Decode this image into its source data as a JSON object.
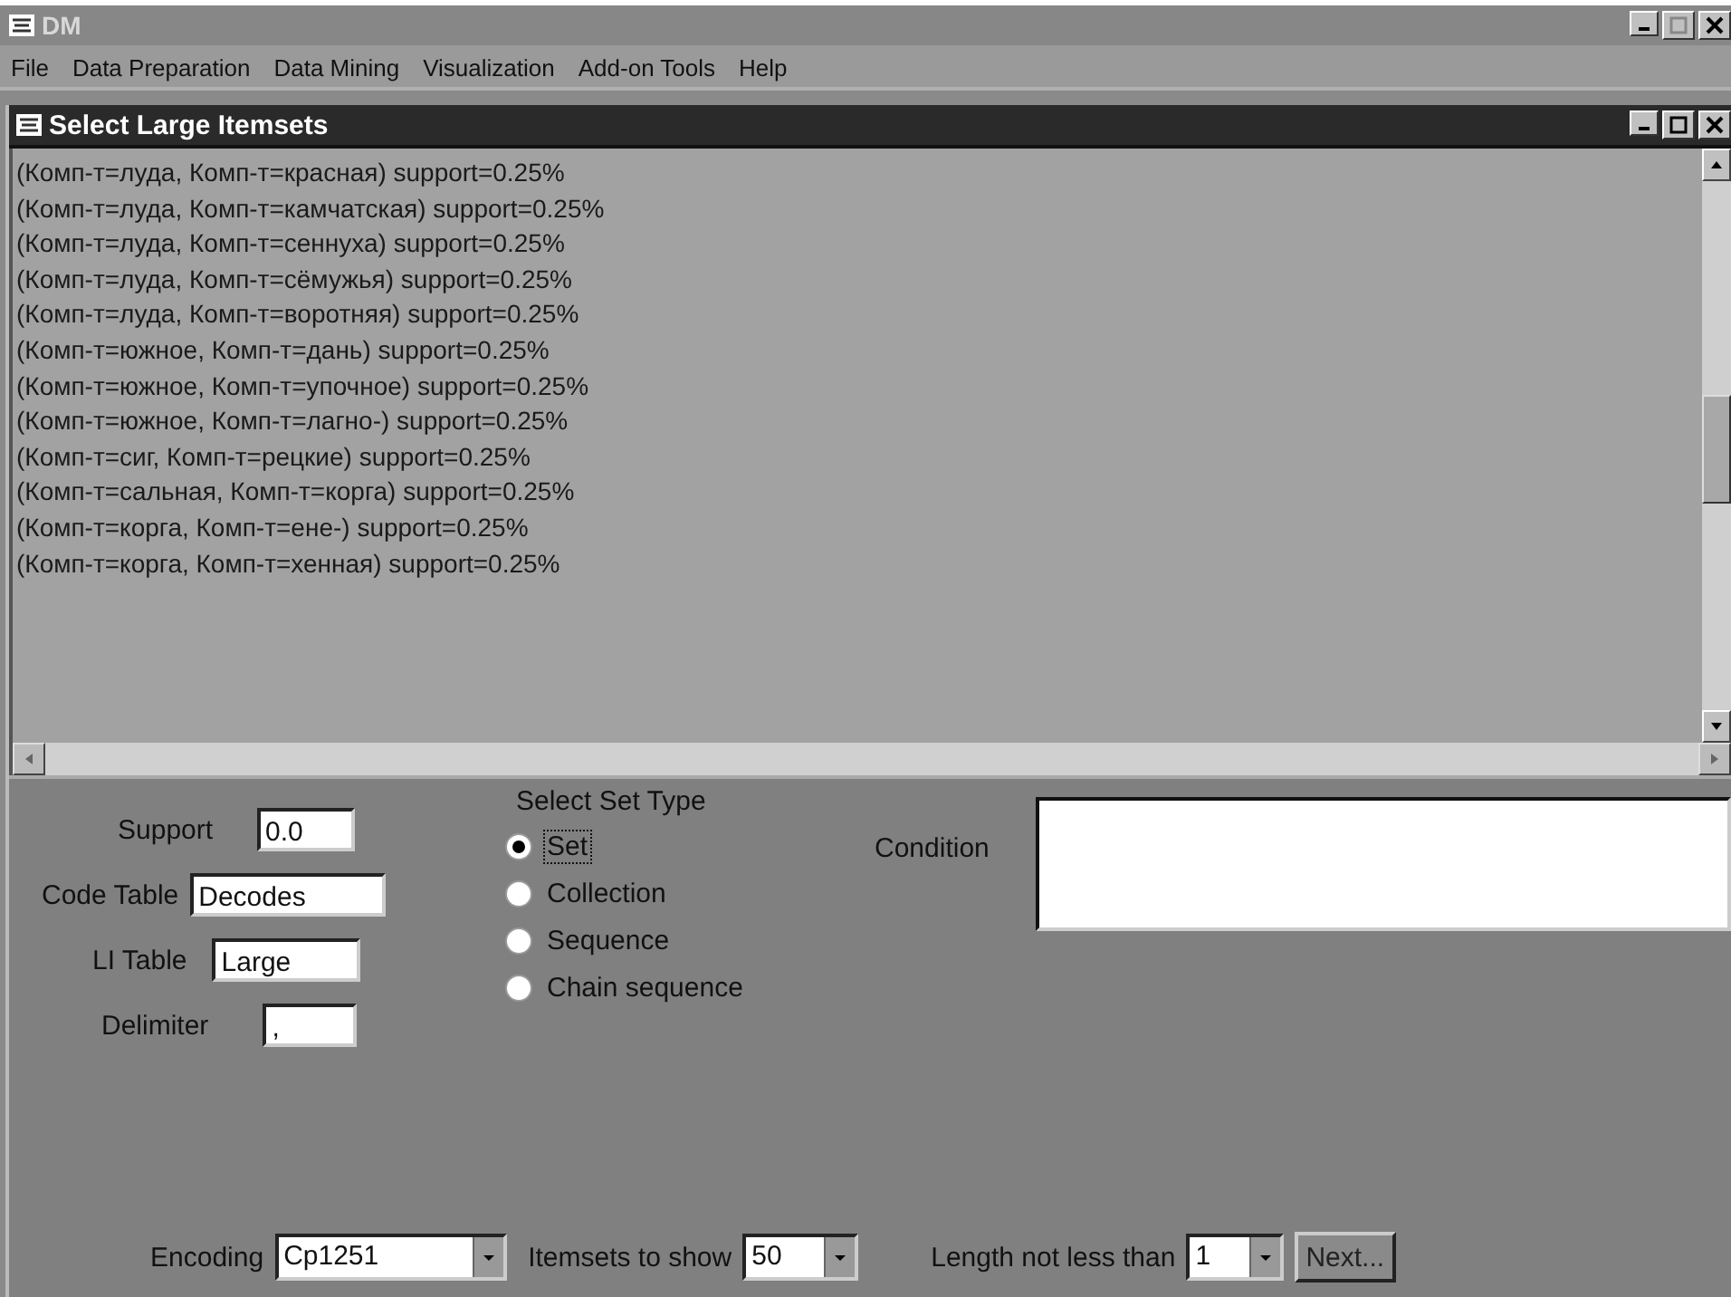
{
  "window": {
    "title": "DM"
  },
  "menu": [
    "File",
    "Data Preparation",
    "Data Mining",
    "Visualization",
    "Add-on Tools",
    "Help"
  ],
  "dialog": {
    "title": "Select Large Itemsets"
  },
  "itemsets": [
    "(Комп-т=луда, Комп-т=красная) support=0.25%",
    "(Комп-т=луда, Комп-т=камчатская) support=0.25%",
    "(Комп-т=луда, Комп-т=сеннуха) support=0.25%",
    "(Комп-т=луда, Комп-т=сёмужья) support=0.25%",
    "(Комп-т=луда, Комп-т=воротняя) support=0.25%",
    "(Комп-т=южное, Комп-т=дань) support=0.25%",
    "(Комп-т=южное, Комп-т=упочное) support=0.25%",
    "(Комп-т=южное, Комп-т=лагно-) support=0.25%",
    "(Комп-т=сиг, Комп-т=рецкие) support=0.25%",
    "(Комп-т=сальная, Комп-т=корга) support=0.25%",
    "(Комп-т=корга, Комп-т=ене-) support=0.25%",
    "(Комп-т=корга, Комп-т=хенная) support=0.25%"
  ],
  "fields": [
    {
      "label": "Support",
      "value": "0.0"
    },
    {
      "label": "Code Table",
      "value": "Decodes"
    },
    {
      "label": "LI Table",
      "value": "Large"
    },
    {
      "label": "Delimiter",
      "value": ","
    }
  ],
  "set_type": {
    "label": "Select Set Type",
    "options": [
      {
        "label": "Set",
        "selected": true
      },
      {
        "label": "Collection",
        "selected": false
      },
      {
        "label": "Sequence",
        "selected": false
      },
      {
        "label": "Chain sequence",
        "selected": false
      }
    ]
  },
  "condition": {
    "label": "Condition"
  },
  "bottom": {
    "encoding": {
      "label": "Encoding",
      "value": "Cp1251"
    },
    "itemsets_to_show": {
      "label": "Itemsets to show",
      "value": "50"
    },
    "min_length": {
      "label": "Length not less than",
      "value": "1"
    },
    "next_button": "Next..."
  }
}
